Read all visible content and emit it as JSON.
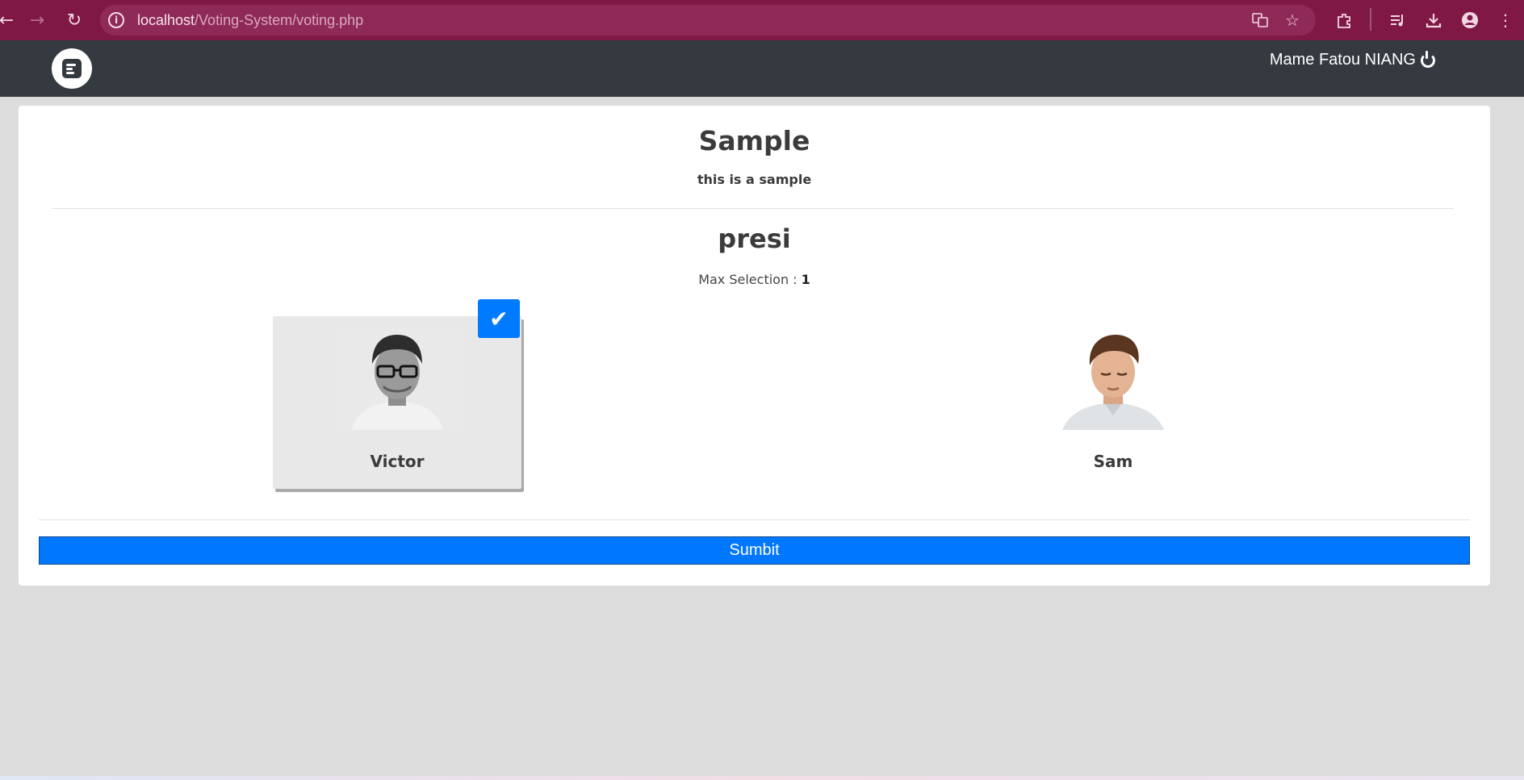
{
  "browser": {
    "url_host": "localhost",
    "url_path": "/Voting-System/voting.php"
  },
  "navbar": {
    "user_name": "Mame Fatou NIANG"
  },
  "election": {
    "title": "Sample",
    "description": "this is a sample"
  },
  "position": {
    "name": "presi",
    "max_selection_label": "Max Selection : ",
    "max_selection_value": "1"
  },
  "candidates": [
    {
      "name": "Victor",
      "selected": true
    },
    {
      "name": "Sam",
      "selected": false
    }
  ],
  "submit_label": "Sumbit",
  "colors": {
    "browser_bar": "#7f1845",
    "navbar": "#343a40",
    "accent": "#007bff",
    "page_bg": "#dcdcdc"
  }
}
